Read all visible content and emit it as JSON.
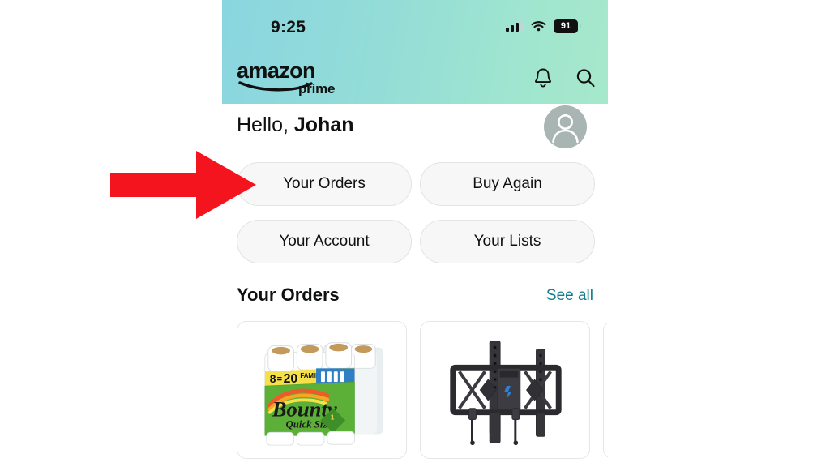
{
  "status_bar": {
    "time": "9:25",
    "battery_level": "91",
    "signal_icon": "cellular-signal-icon",
    "wifi_icon": "wifi-icon",
    "battery_icon": "battery-icon"
  },
  "header": {
    "brand": "amazon",
    "brand_sub": "prime",
    "gradient_start": "#8ad6e0",
    "gradient_end": "#a6e8cb",
    "notifications_icon": "bell-icon",
    "search_icon": "search-icon"
  },
  "account": {
    "greeting_prefix": "Hello,",
    "user_name": "Johan",
    "avatar_icon": "user-avatar-icon"
  },
  "quick_actions": [
    {
      "label": "Your Orders",
      "name": "your-orders"
    },
    {
      "label": "Buy Again",
      "name": "buy-again"
    },
    {
      "label": "Your Account",
      "name": "your-account"
    },
    {
      "label": "Your Lists",
      "name": "your-lists"
    }
  ],
  "orders_section": {
    "title": "Your Orders",
    "see_all_label": "See all",
    "see_all_color": "#127d8e",
    "items": [
      {
        "name": "bounty-paper-towels",
        "alt": "Bounty Quick Size paper towels, 8 = 20 Family rolls",
        "badge_count": "8",
        "badge_equiv": "20",
        "badge_word": "FAMILY",
        "brand": "Bounty",
        "sub_brand": "Quick Size"
      },
      {
        "name": "tv-wall-mount",
        "alt": "Black tilting TV wall mount bracket"
      },
      {
        "name": "third-order-item",
        "alt": "Partially visible order item"
      }
    ]
  },
  "annotation": {
    "arrow_color": "#f4141e",
    "arrow_target": "Your Orders",
    "arrow_icon": "red-right-arrow-icon"
  }
}
